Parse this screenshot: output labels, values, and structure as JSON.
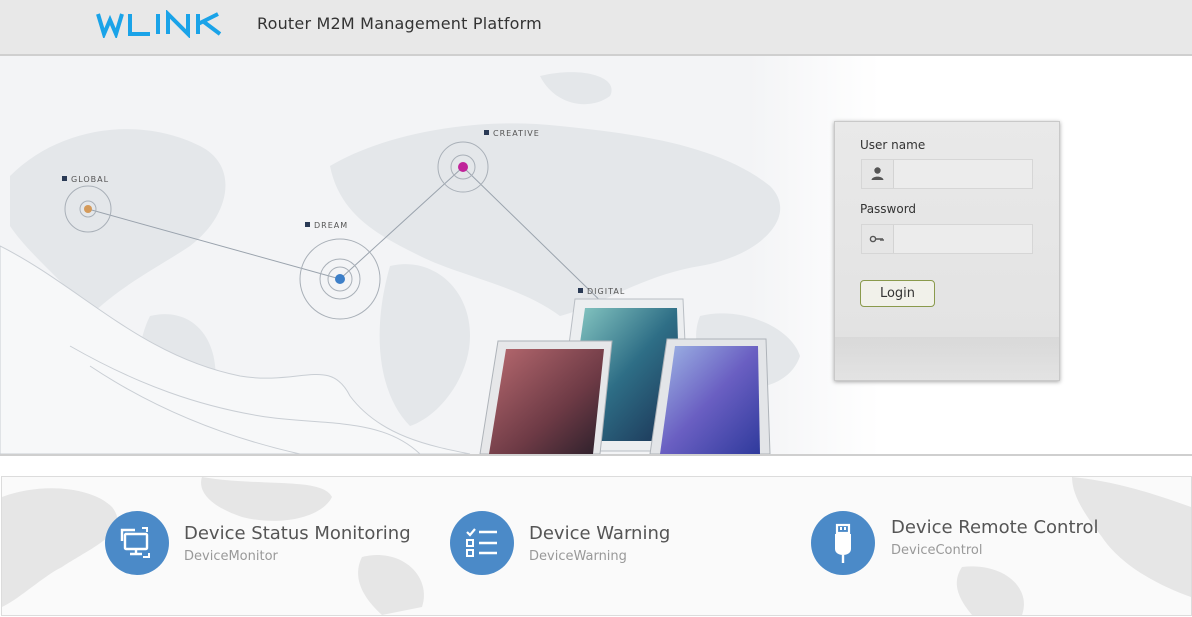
{
  "header": {
    "logo_text": "WLINK",
    "title": "Router M2M Management Platform"
  },
  "hero": {
    "labels": {
      "global": "GLOBAL",
      "dream": "DREAM",
      "creative": "CREATIVE",
      "digital": "DIGITAL"
    }
  },
  "login": {
    "username_label": "User name",
    "username_value": "",
    "username_icon": "user-icon",
    "password_label": "Password",
    "password_value": "",
    "password_icon": "key-icon",
    "button_label": "Login",
    "button_border_color": "#8a9a4c"
  },
  "features": [
    {
      "title": "Device Status Monitoring",
      "subtitle": "DeviceMonitor",
      "icon": "monitor-sync-icon"
    },
    {
      "title": "Device Warning",
      "subtitle": "DeviceWarning",
      "icon": "checklist-icon"
    },
    {
      "title": "Device Remote Control",
      "subtitle": "DeviceControl",
      "icon": "usb-icon"
    }
  ],
  "colors": {
    "brand_blue": "#1aa3e8",
    "feature_icon_blue": "#4b8ac8",
    "header_bg": "#e8e8e8"
  }
}
